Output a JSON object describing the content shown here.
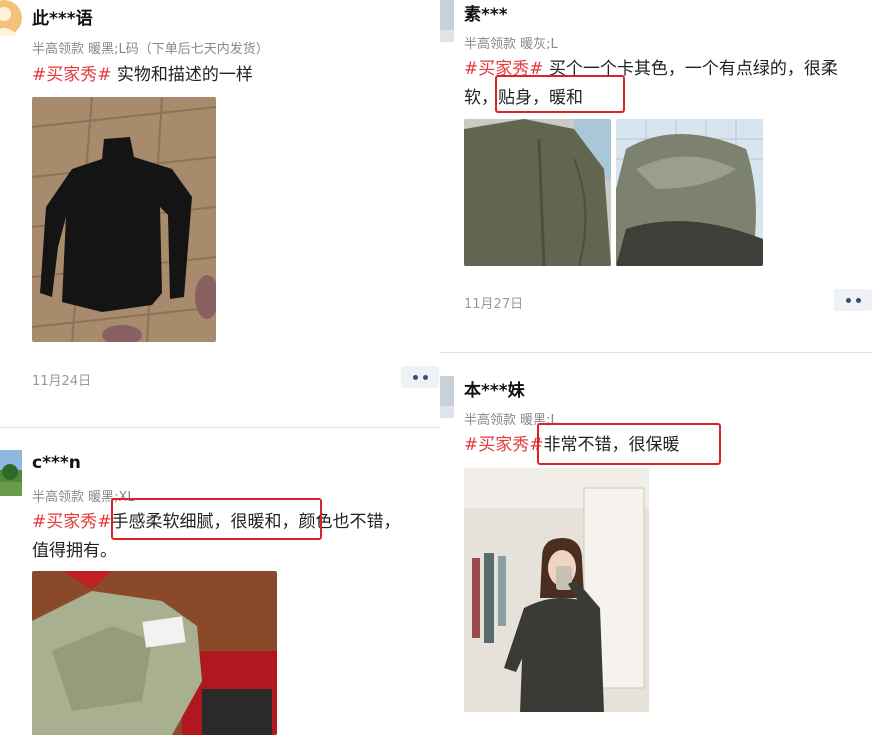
{
  "reviews": [
    {
      "user": "此***语",
      "spec": "半高领款 暖黑;L码（下单后七天内发货）",
      "tag": "#买家秀#",
      "text": " 实物和描述的一样",
      "date": "11月24日"
    },
    {
      "user": "c***n",
      "spec": "半高领款 暖黑;XL",
      "tag": "#买家秀#",
      "text_highlight": "手感柔软细腻，很暖和，",
      "text_line1_rest": "颜色也不错，",
      "text_line2": "值得拥有。"
    },
    {
      "user": "素***",
      "spec": "半高领款 暖灰;L",
      "tag": "#买家秀#",
      "text_line1": " 买个一个卡其色，一个有点绿的，很柔",
      "text_line2_a": "软，",
      "text_highlight": "贴身，暖和",
      "date": "11月27日"
    },
    {
      "user": "本***妹",
      "spec": "半高领款 暖黑;L",
      "tag": "#买家秀#",
      "text_highlight": "非常不错，很保暖"
    }
  ],
  "colors": {
    "tag": "#e4393c",
    "highlight_box": "#d8232a",
    "date": "#999999",
    "more_button_bg": "#eef1f6"
  },
  "icons": {
    "more": "more-dots-icon"
  }
}
